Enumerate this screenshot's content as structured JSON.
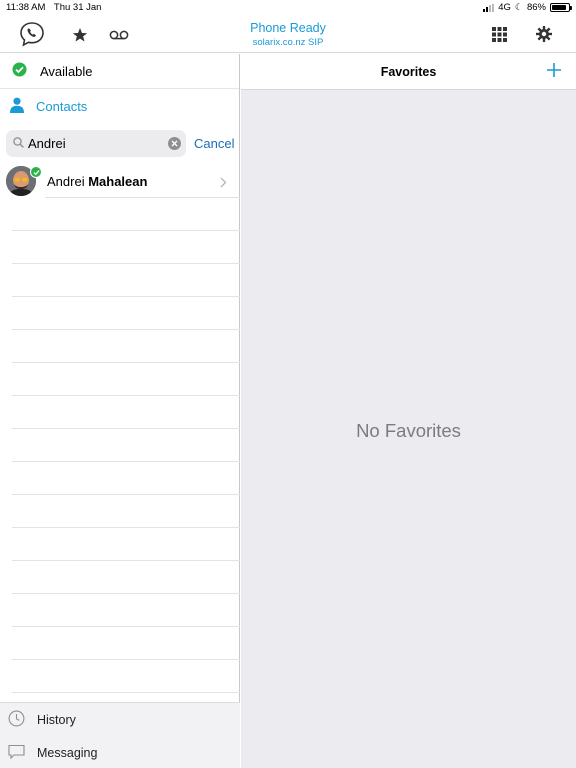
{
  "status_bar": {
    "time": "11:38 AM",
    "date": "Thu 31 Jan",
    "network": "4G",
    "battery": "86%",
    "battery_level": 0.86
  },
  "toolbar": {
    "phone_status": "Phone Ready",
    "account": "solarix.co.nz SIP",
    "icons": [
      "phone-bubble-icon",
      "star-icon",
      "voicemail-icon",
      "keypad-icon",
      "gear-icon"
    ]
  },
  "sidebar": {
    "presence": "Available",
    "contacts_label": "Contacts",
    "search": {
      "value": "Andrei",
      "cancel_label": "Cancel"
    },
    "results": [
      {
        "first": "Andrei",
        "last": "Mahalean",
        "status": "online"
      }
    ],
    "bottom_nav": [
      {
        "label": "History",
        "icon": "clock-icon"
      },
      {
        "label": "Messaging",
        "icon": "chat-icon"
      }
    ]
  },
  "main": {
    "title": "Favorites",
    "empty_text": "No Favorites"
  },
  "colors": {
    "accent": "#1a9ad6",
    "link": "#1a6eb8",
    "available": "#2cb24a",
    "panel_bg": "#ebebf0"
  }
}
